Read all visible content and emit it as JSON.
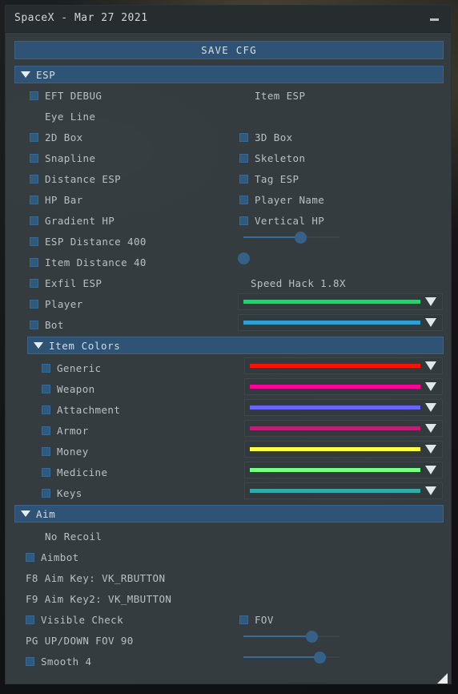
{
  "window": {
    "title": "SpaceX - Mar 27 2021",
    "minimize_label": "-"
  },
  "toolbar": {
    "save_label": "SAVE CFG"
  },
  "sections": {
    "esp": {
      "label": "ESP"
    },
    "item_colors": {
      "label": "Item Colors"
    },
    "aim": {
      "label": "Aim"
    }
  },
  "esp": {
    "eft_debug": "EFT DEBUG",
    "item_esp": "Item ESP",
    "eye_line": "Eye Line",
    "box_2d": "2D Box",
    "box_3d": "3D Box",
    "snapline": "Snapline",
    "skeleton": "Skeleton",
    "distance_esp": "Distance ESP",
    "tag_esp": "Tag ESP",
    "hp_bar": "HP Bar",
    "player_name": "Player Name",
    "gradient_hp": "Gradient HP",
    "vertical_hp": "Vertical HP",
    "esp_distance": "ESP Distance 400",
    "item_distance": "Item Distance 40",
    "exfil_esp": "Exfil ESP",
    "speed_hack": "Speed Hack 1.8X",
    "player": "Player",
    "bot": "Bot"
  },
  "sliders": {
    "esp_distance": {
      "value": 400,
      "percent": 59
    },
    "item_distance": {
      "value": 40,
      "percent": 0
    },
    "fov": {
      "value": 90,
      "percent": 71
    },
    "smooth": {
      "value": 4,
      "percent": 79
    }
  },
  "colors": {
    "player": "#2ecc71",
    "bot": "#2e9fd0",
    "generic": "#ff1100",
    "weapon": "#ff0099",
    "attachment": "#6666ff",
    "armor": "#bb2277",
    "money": "#ffff44",
    "medicine": "#77ff88",
    "keys": "#33aaaa",
    "accent": "#2f5374",
    "checkbox": "#2f5a7e",
    "panel_bg": "#343c40",
    "titlebar_bg": "#272c2f"
  },
  "item_colors": {
    "generic": "Generic",
    "weapon": "Weapon",
    "attachment": "Attachment",
    "armor": "Armor",
    "money": "Money",
    "medicine": "Medicine",
    "keys": "Keys"
  },
  "aim": {
    "no_recoil": "No Recoil",
    "aimbot": "Aimbot",
    "aim_key": "F8 Aim Key: VK_RBUTTON",
    "aim_key2": "F9 Aim Key2: VK_MBUTTON",
    "visible_check": "Visible Check",
    "fov": "FOV",
    "fov_value": "PG UP/DOWN FOV 90",
    "smooth": "Smooth 4"
  }
}
